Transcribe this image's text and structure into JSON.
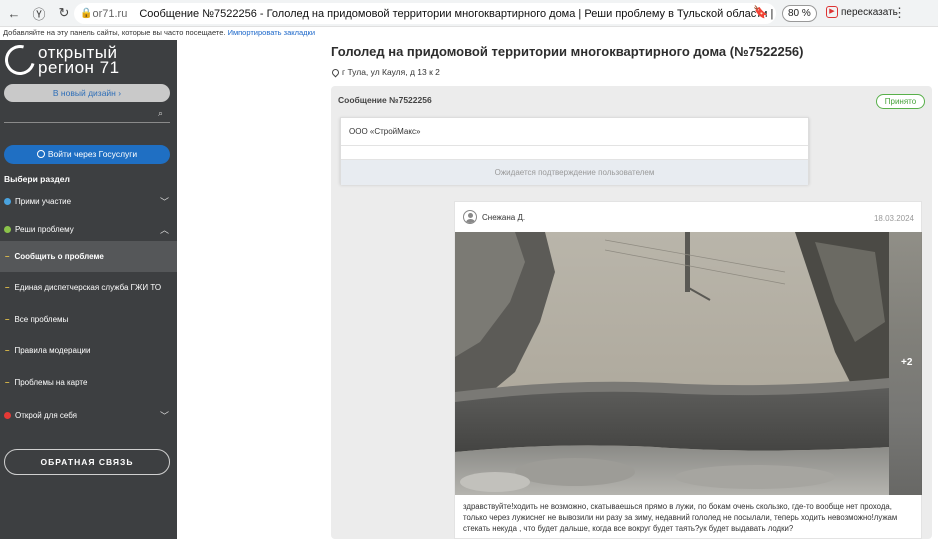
{
  "browser": {
    "domain": "or71.ru",
    "tab_title": "Сообщение №7522256 - Гололед на придомовой территории многоквартирного дома | Реши проблему в Тульской области | Открыт...",
    "zoom": "80 %",
    "retell": "пересказать",
    "bookmarks_text": "Добавляйте на эту панель сайты, которые вы часто посещаете.",
    "bookmarks_link": "Импортировать закладки"
  },
  "sidebar": {
    "logo_line1": "открытый",
    "logo_line2": "регион 71",
    "new_design": "В новый дизайн",
    "gosuslugi": "Войти через Госуслуги",
    "section_title": "Выбери раздел",
    "items": [
      {
        "label": "Прими участие",
        "color": "#4aa3df"
      },
      {
        "label": "Реши проблему",
        "color": "#8bc34a"
      },
      {
        "label": "Открой для себя",
        "color": "#e53935"
      }
    ],
    "subitems": [
      "Сообщить о проблеме",
      "Единая диспетчерская служба ГЖИ ТО",
      "Все проблемы",
      "Правила модерации",
      "Проблемы на карте"
    ],
    "feedback": "ОБРАТНАЯ СВЯЗЬ"
  },
  "main": {
    "title": "Гололед на придомовой территории многоквартирного дома (№7522256)",
    "address": "г Тула, ул Кауля, д 13 к 2",
    "message_number": "Сообщение №7522256",
    "status": "Принято",
    "org_name": "ООО «СтройМакс»",
    "waiting": "Ожидается подтверждение пользователем",
    "post": {
      "author": "Снежана Д.",
      "date": "18.03.2024",
      "more_photos": "+2",
      "text": "здравствуйте!ходить не возможно, скатываешься прямо в лужи, по бокам очень скользко, где-то вообще нет прохода, только через лужиснег не вывозили ни разу за зиму, недавний гололед не посылали, теперь ходить невозможно!лужам стекать некуда , что будет дальше, когда все вокруг будет таять?ук будет выдавать лодки?"
    }
  }
}
